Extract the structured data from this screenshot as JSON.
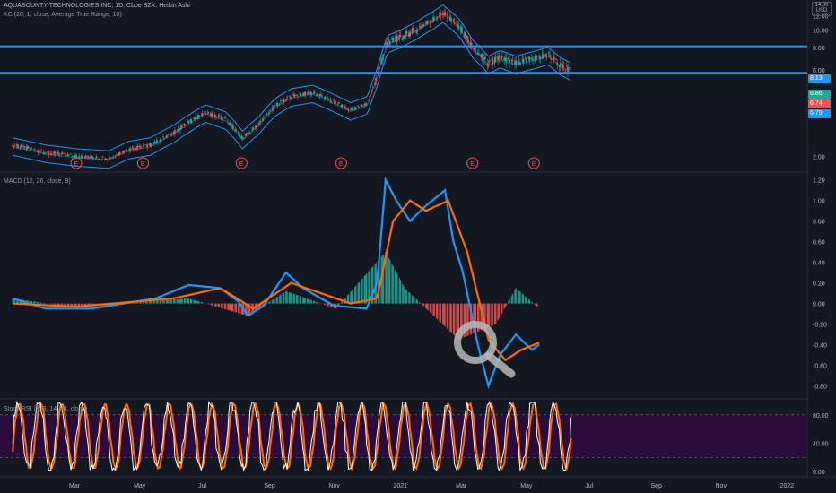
{
  "header": {
    "title": "AQUABOUNTY TECHNOLOGIES INC, 1D, Cboe BZX, Heikin Ashi",
    "kc_label": "KC (20, 1, close, Average True Range, 10)",
    "macd_label": "MACD (12, 26, close, 9)",
    "stoch_label": "Stoch RSI (3, 3, 14, 14, close)",
    "currency": "14.00\nUSD"
  },
  "price_tags": [
    {
      "label": "8.13",
      "color": "#2196f3"
    },
    {
      "label": "6.86",
      "color": "#26a69a"
    },
    {
      "label": "6.74",
      "color": "#ef5350"
    },
    {
      "label": "5.79",
      "color": "#2196f3"
    }
  ],
  "colors": {
    "background": "#131722",
    "up": "#26a69a",
    "down": "#ef5350",
    "kc": "#2196f3",
    "macd_line": "#2196f3",
    "signal_line": "#ff6d00",
    "stoch_k": "#ffffff",
    "stoch_d": "#ff6d00",
    "stoch_band": "#2a0b3a",
    "hline": "#2196f3"
  },
  "chart_data": [
    {
      "type": "candlestick",
      "name": "price",
      "scale": "log",
      "ylim": [
        1.75,
        14
      ],
      "y_ticks": [
        "12.00",
        "10.00",
        "8.00",
        "6.00",
        "4.00",
        "2.00"
      ],
      "horizontal_lines": [
        8.13,
        5.79
      ],
      "earnings_markers": {
        "label": "E",
        "dates": [
          "2020-03-01",
          "2020-05-03",
          "2020-08-04",
          "2020-11-06",
          "2021-03-10",
          "2021-05-07"
        ]
      },
      "approx_path": [
        [
          "2020-01-01",
          2.3
        ],
        [
          "2020-02-01",
          2.1
        ],
        [
          "2020-03-01",
          2.0
        ],
        [
          "2020-04-01",
          1.95
        ],
        [
          "2020-04-20",
          2.2
        ],
        [
          "2020-05-10",
          2.3
        ],
        [
          "2020-06-01",
          2.7
        ],
        [
          "2020-07-01",
          3.5
        ],
        [
          "2020-07-20",
          3.2
        ],
        [
          "2020-08-05",
          2.5
        ],
        [
          "2020-08-20",
          3.0
        ],
        [
          "2020-09-05",
          3.8
        ],
        [
          "2020-09-20",
          4.3
        ],
        [
          "2020-10-10",
          4.5
        ],
        [
          "2020-10-30",
          4.0
        ],
        [
          "2020-11-15",
          3.6
        ],
        [
          "2020-12-01",
          3.9
        ],
        [
          "2020-12-10",
          5.5
        ],
        [
          "2020-12-20",
          8.5
        ],
        [
          "2020-12-31",
          9.0
        ],
        [
          "2021-01-15",
          10.0
        ],
        [
          "2021-02-01",
          11.5
        ],
        [
          "2021-02-10",
          12.5
        ],
        [
          "2021-02-25",
          10.5
        ],
        [
          "2021-03-10",
          8.0
        ],
        [
          "2021-03-25",
          6.5
        ],
        [
          "2021-04-05",
          7.0
        ],
        [
          "2021-04-20",
          6.5
        ],
        [
          "2021-05-10",
          7.0
        ],
        [
          "2021-05-20",
          7.3
        ],
        [
          "2021-06-01",
          6.4
        ],
        [
          "2021-06-10",
          6.0
        ]
      ]
    },
    {
      "type": "line",
      "name": "MACD",
      "ylim": [
        -0.9,
        1.25
      ],
      "y_ticks": [
        "1.20",
        "1.00",
        "0.80",
        "0.60",
        "0.40",
        "0.20",
        "0.00",
        "-0.20",
        "-0.40",
        "-0.60",
        "-0.80"
      ],
      "macd": [
        [
          "2020-01-01",
          0.05
        ],
        [
          "2020-02-01",
          -0.05
        ],
        [
          "2020-03-15",
          -0.05
        ],
        [
          "2020-04-15",
          0.0
        ],
        [
          "2020-05-15",
          0.05
        ],
        [
          "2020-06-15",
          0.18
        ],
        [
          "2020-07-15",
          0.15
        ],
        [
          "2020-08-01",
          0.02
        ],
        [
          "2020-08-10",
          -0.12
        ],
        [
          "2020-08-25",
          -0.02
        ],
        [
          "2020-09-15",
          0.3
        ],
        [
          "2020-10-01",
          0.15
        ],
        [
          "2020-10-30",
          -0.02
        ],
        [
          "2020-11-30",
          -0.05
        ],
        [
          "2020-12-10",
          0.2
        ],
        [
          "2020-12-18",
          1.2
        ],
        [
          "2020-12-28",
          1.0
        ],
        [
          "2021-01-10",
          0.8
        ],
        [
          "2021-01-25",
          0.95
        ],
        [
          "2021-02-12",
          1.1
        ],
        [
          "2021-02-20",
          0.6
        ],
        [
          "2021-03-01",
          0.3
        ],
        [
          "2021-03-15",
          -0.4
        ],
        [
          "2021-03-25",
          -0.8
        ],
        [
          "2021-04-05",
          -0.5
        ],
        [
          "2021-04-20",
          -0.3
        ],
        [
          "2021-05-05",
          -0.45
        ],
        [
          "2021-05-12",
          -0.4
        ]
      ],
      "signal": [
        [
          "2020-01-01",
          0.0
        ],
        [
          "2020-03-01",
          -0.03
        ],
        [
          "2020-06-01",
          0.05
        ],
        [
          "2020-07-15",
          0.15
        ],
        [
          "2020-08-15",
          -0.05
        ],
        [
          "2020-09-20",
          0.2
        ],
        [
          "2020-11-15",
          0.0
        ],
        [
          "2020-12-10",
          0.05
        ],
        [
          "2020-12-25",
          0.8
        ],
        [
          "2021-01-10",
          1.0
        ],
        [
          "2021-01-25",
          0.9
        ],
        [
          "2021-02-15",
          1.0
        ],
        [
          "2021-03-05",
          0.5
        ],
        [
          "2021-03-25",
          -0.35
        ],
        [
          "2021-04-10",
          -0.55
        ],
        [
          "2021-04-25",
          -0.45
        ],
        [
          "2021-05-12",
          -0.38
        ]
      ],
      "histogram": [
        [
          "2020-01-01",
          0.05
        ],
        [
          "2020-03-01",
          -0.04
        ],
        [
          "2020-06-15",
          0.05
        ],
        [
          "2020-08-10",
          -0.12
        ],
        [
          "2020-09-15",
          0.12
        ],
        [
          "2020-11-01",
          -0.05
        ],
        [
          "2020-12-18",
          0.5
        ],
        [
          "2021-01-05",
          0.15
        ],
        [
          "2021-02-25",
          -0.35
        ],
        [
          "2021-04-01",
          -0.2
        ],
        [
          "2021-04-20",
          0.15
        ],
        [
          "2021-05-10",
          -0.03
        ]
      ]
    },
    {
      "type": "line",
      "name": "Stoch RSI",
      "ylim": [
        -5,
        100
      ],
      "y_ticks": [
        "80.00",
        "40.00",
        "0.00"
      ],
      "bands": [
        20,
        80
      ]
    }
  ],
  "x_axis": {
    "labels": [
      "Mar",
      "May",
      "Jul",
      "Sep",
      "Nov",
      "2021",
      "Mar",
      "May",
      "Jul",
      "Sep",
      "Nov",
      "2022"
    ]
  }
}
